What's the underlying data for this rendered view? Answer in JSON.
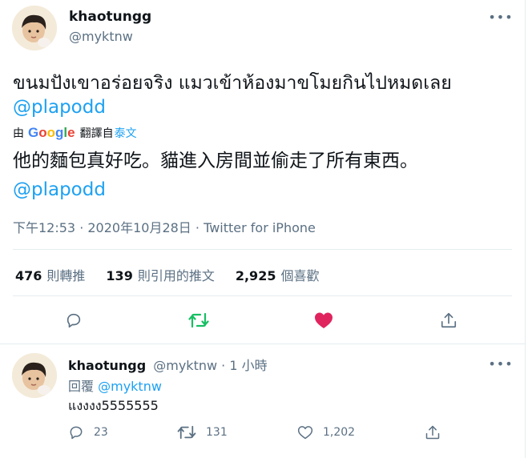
{
  "tweet": {
    "display_name": "khaotungg",
    "handle": "@myktnw",
    "text_line1": "ขนมปังเขาอร่อยจริง แมวเข้าห้องมาขโมยกินไปหมดเลย",
    "mention": "@plapodd",
    "translate": {
      "prefix": "由",
      "provider": "Google",
      "label": "翻譯自",
      "source_language": "泰文"
    },
    "translated_line1": "他的麵包真好吃。貓進入房間並偷走了所有東西。",
    "translated_mention": "@plapodd",
    "meta": "下午12:53 · 2020年10月28日 · Twitter for iPhone",
    "stats": {
      "retweets_count": "476",
      "retweets_label": "則轉推",
      "quotes_count": "139",
      "quotes_label": "則引用的推文",
      "likes_count": "2,925",
      "likes_label": "個喜歡"
    },
    "actions": [
      "reply-icon",
      "retweet-icon",
      "heart-icon",
      "share-icon"
    ],
    "colors": {
      "retweet_active": "#17bf63",
      "like_active": "#e0245e",
      "link": "#1da1f2"
    }
  },
  "reply": {
    "display_name": "khaotungg",
    "handle": "@myktnw",
    "separator": "·",
    "time": "1 小時",
    "replying_label": "回覆",
    "replying_to": "@myktnw",
    "text": "แงงงง5555555",
    "reply_count": "23",
    "retweet_count": "131",
    "like_count": "1,202"
  }
}
